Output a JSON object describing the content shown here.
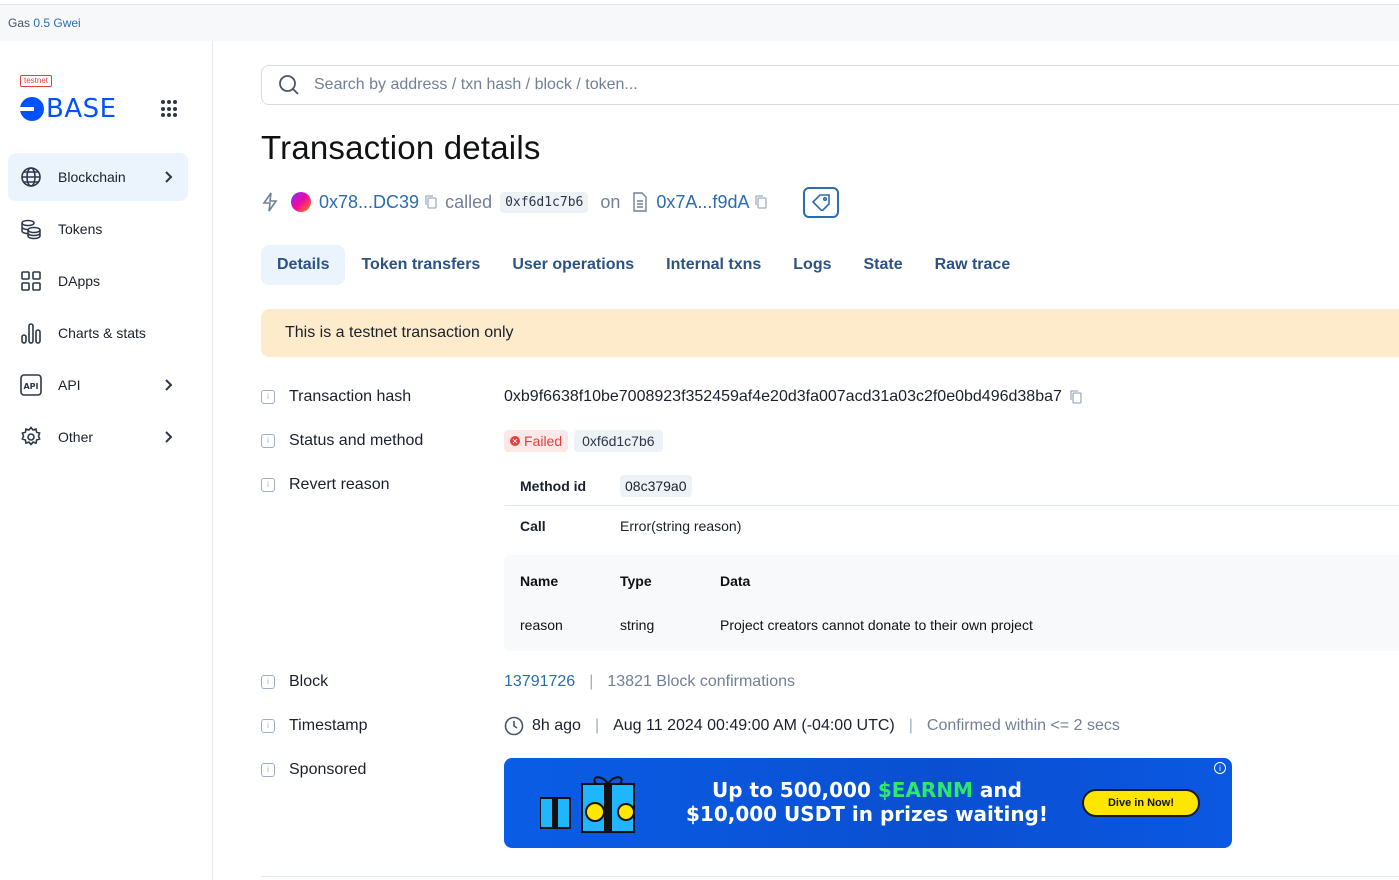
{
  "topbar": {
    "gas_label": "Gas",
    "gas_value": "0.5 Gwei"
  },
  "sidebar": {
    "testnet_tag": "testnet",
    "logo_text": "BASE",
    "items": [
      {
        "label": "Blockchain",
        "icon": "globe-icon",
        "active": true,
        "has_chevron": true
      },
      {
        "label": "Tokens",
        "icon": "coins-icon",
        "active": false,
        "has_chevron": false
      },
      {
        "label": "DApps",
        "icon": "apps-grid-icon",
        "active": false,
        "has_chevron": false
      },
      {
        "label": "Charts & stats",
        "icon": "bar-chart-icon",
        "active": false,
        "has_chevron": false
      },
      {
        "label": "API",
        "icon": "api-icon",
        "active": false,
        "has_chevron": true
      },
      {
        "label": "Other",
        "icon": "gear-icon",
        "active": false,
        "has_chevron": true
      }
    ]
  },
  "search": {
    "placeholder": "Search by address / txn hash / block / token..."
  },
  "page": {
    "title": "Transaction details",
    "from_address": "0x78...DC39",
    "called_text": "called",
    "method_badge": "0xf6d1c7b6",
    "on_text": "on",
    "to_address": "0x7A...f9dA"
  },
  "tabs": [
    "Details",
    "Token transfers",
    "User operations",
    "Internal txns",
    "Logs",
    "State",
    "Raw trace"
  ],
  "banner": "This is a testnet transaction only",
  "details": {
    "hash_label": "Transaction hash",
    "hash_value": "0xb9f6638f10be7008923f352459af4e20d3fa007acd31a03c2f0e0bd496d38ba7",
    "status_label": "Status and method",
    "status_value": "Failed",
    "method_value": "0xf6d1c7b6",
    "revert_label": "Revert reason",
    "revert": {
      "method_id_label": "Method id",
      "method_id_value": "08c379a0",
      "call_label": "Call",
      "call_value": "Error(string reason)",
      "headers": [
        "Name",
        "Type",
        "Data"
      ],
      "row": [
        "reason",
        "string",
        "Project creators cannot donate to their own project"
      ]
    },
    "block_label": "Block",
    "block_value": "13791726",
    "block_confirmations": "13821 Block confirmations",
    "timestamp_label": "Timestamp",
    "timestamp_ago": "8h ago",
    "timestamp_full": "Aug 11 2024 00:49:00 AM (-04:00 UTC)",
    "timestamp_confirmed": "Confirmed within <= 2 secs",
    "sponsored_label": "Sponsored"
  },
  "ad": {
    "line1_a": "Up to 500,000 ",
    "line1_green": "$EARNM",
    "line1_b": " and",
    "line2": "$10,000 USDT in prizes waiting!",
    "button": "Dive in Now!",
    "colors": {
      "background": "#0a5de6",
      "accent": "#2ee86b",
      "button": "#ffe600"
    }
  },
  "colors": {
    "link": "#2b6cb0",
    "tab_active_bg": "#ebf4fd",
    "banner_bg": "#feebcb",
    "failed": "#e53e3e"
  }
}
